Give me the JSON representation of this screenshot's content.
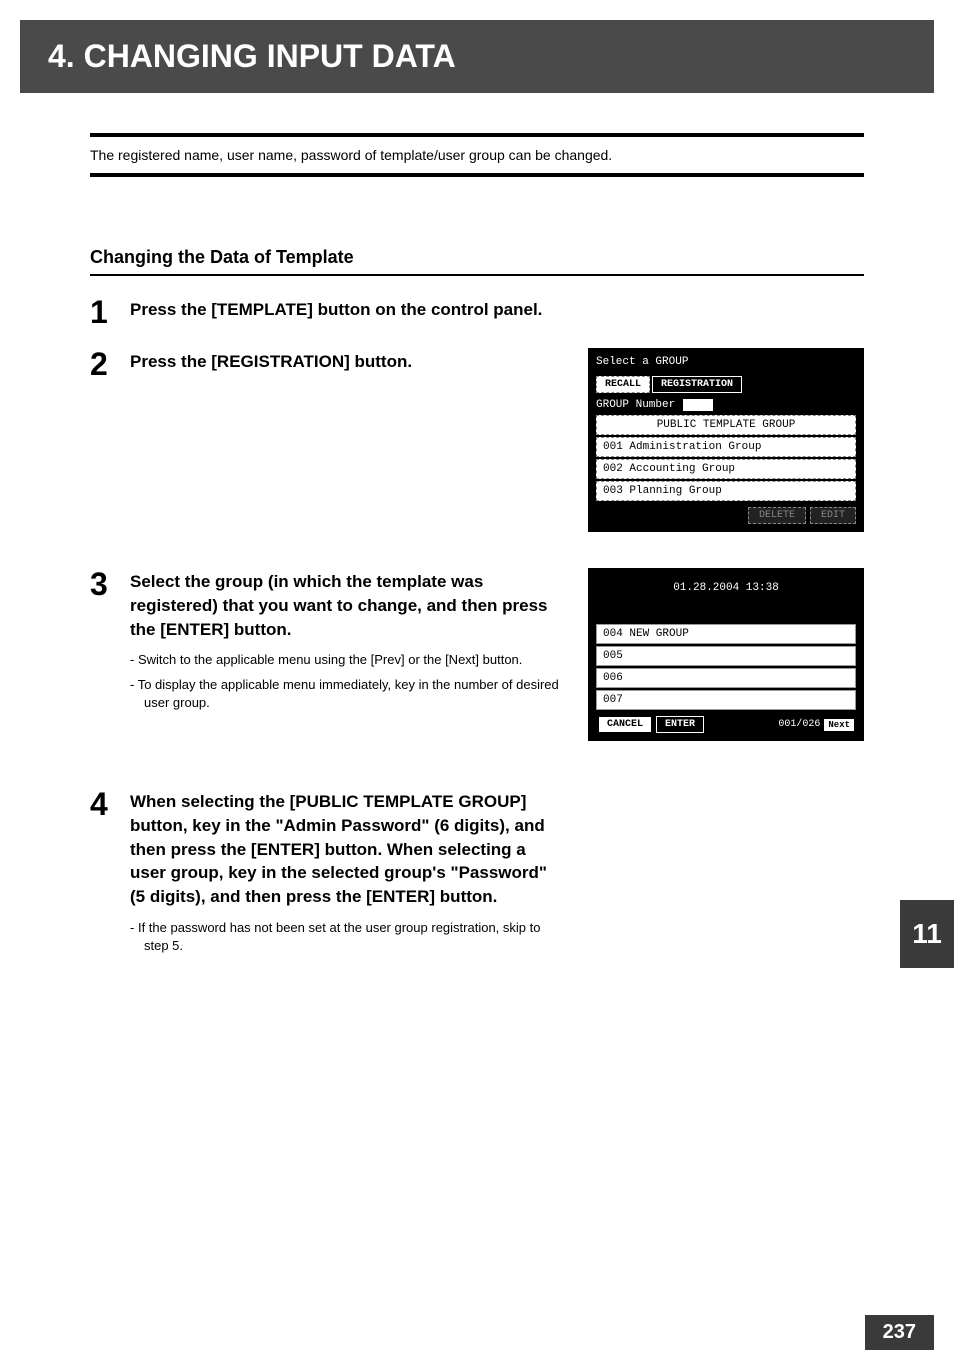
{
  "header": "4. CHANGING INPUT DATA",
  "intro": "The registered name, user name, password of template/user group can be changed.",
  "section_title": "Changing the Data of Template",
  "steps": [
    {
      "num": "1",
      "title": "Press the [TEMPLATE] button on the control panel."
    },
    {
      "num": "2",
      "title": "Press the [REGISTRATION] button."
    },
    {
      "num": "3",
      "title": "Select the group (in which the template was registered) that you want to change, and then press the [ENTER] button.",
      "notes": [
        "Switch to the applicable menu using the [Prev] or the [Next] button.",
        "To display the applicable menu immediately, key in the number of desired user group."
      ]
    },
    {
      "num": "4",
      "title": "When selecting the [PUBLIC TEMPLATE GROUP] button, key in the \"Admin Password\" (6 digits), and then press the [ENTER] button. When selecting a user group, key in the selected group's \"Password\" (5 digits), and then press the [ENTER] button.",
      "notes": [
        "If the password has not been set at the user group registration, skip to step 5."
      ]
    }
  ],
  "screenshot1": {
    "title": "Select a GROUP",
    "tab_recall": "RECALL",
    "tab_registration": "REGISTRATION",
    "group_number_label": "GROUP Number",
    "rows": [
      "PUBLIC TEMPLATE GROUP",
      "001 Administration Group",
      "002 Accounting Group",
      "003 Planning Group"
    ],
    "btn_delete": "DELETE",
    "btn_edit": "EDIT"
  },
  "screenshot2": {
    "timestamp": "01.28.2004 13:38",
    "rows": [
      "004 NEW GROUP",
      "005",
      "006",
      "007"
    ],
    "btn_cancel": "CANCEL",
    "btn_enter": "ENTER",
    "pager": "001/026",
    "btn_next": "Next"
  },
  "side_tab": "11",
  "page_number": "237"
}
